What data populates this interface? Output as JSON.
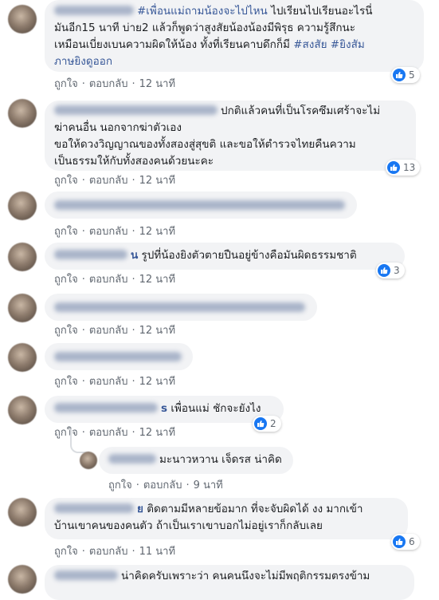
{
  "actions": {
    "like": "ถูกใจ",
    "reply": "ตอบกลับ",
    "dot": "·"
  },
  "colors": {
    "bubble": "#f2f3f5",
    "link": "#385898",
    "meta": "#606770",
    "like_blue": "#1877f2"
  },
  "comments": [
    {
      "name_tail": "",
      "lines": [
        {
          "segments": [
            {
              "t": "#เพื่อนแม่ถามน้องจะไปไหน",
              "link": true
            },
            {
              "t": " ไปเรียนไปเรียนอะไรนี่"
            }
          ]
        },
        {
          "segments": [
            {
              "t": "มันอีก15 นาที บ่าย2 แล้วก็พูดว่าสูงสัยน้องน้องมีพิรุธ ความรู้สึกนะ"
            }
          ]
        },
        {
          "segments": [
            {
              "t": "เหมือนเบี่ยงเบนความผิดให้น้อง ทั้งที่เรียนคาบดึกก็มี "
            },
            {
              "t": "#สงสัย #ยิงสัม",
              "link": true
            }
          ]
        },
        {
          "segments": [
            {
              "t": "ภาษยิงดูออก",
              "link": true
            }
          ]
        }
      ],
      "time": "12 นาที",
      "reaction_count": "5"
    },
    {
      "name_tail": "",
      "lines": [
        {
          "segments": [
            {
              "t": "ปกติแล้วคนที่เป็นโรคซึมเศร้าจะไม่"
            }
          ]
        },
        {
          "segments": [
            {
              "t": "ฆ่าคนอื่น นอกจากฆ่าตัวเอง"
            }
          ]
        },
        {
          "segments": [
            {
              "t": "ขอให้ดวงวิญญาณของทั้งสองสู่สุขติ และขอให้ตำรวจไทยคืนความ"
            }
          ]
        },
        {
          "segments": [
            {
              "t": "เป็นธรรมให้กับทั้งสองคนด้วยนะคะ"
            }
          ]
        }
      ],
      "time": "12 นาที",
      "reaction_count": "13"
    },
    {
      "name_tail": "",
      "lines": [
        {
          "segments": [
            {
              "t": ""
            }
          ]
        }
      ],
      "time": "12 นาที",
      "reaction_count": ""
    },
    {
      "name_tail": "น",
      "lines": [
        {
          "segments": [
            {
              "t": "รูปที่น้องยิงตัวตายปืนอยู่ข้างคือมันผิดธรรมชาติ"
            }
          ]
        }
      ],
      "time": "12 นาที",
      "reaction_count": "3"
    },
    {
      "name_tail": "",
      "lines": [
        {
          "segments": [
            {
              "t": ""
            }
          ]
        }
      ],
      "time": "12 นาที",
      "reaction_count": ""
    },
    {
      "name_tail": "",
      "lines": [
        {
          "segments": [
            {
              "t": ""
            }
          ]
        }
      ],
      "time": "12 นาที",
      "reaction_count": ""
    },
    {
      "name_tail": "s",
      "lines": [
        {
          "segments": [
            {
              "t": "เพื่อนแม่ ชักจะยังไง"
            }
          ]
        }
      ],
      "time": "12 นาที",
      "reaction_count": "2"
    },
    {
      "name_tail": "",
      "lines": [
        {
          "segments": [
            {
              "t": "มะนาวหวาน เจ็ดรส น่าคิด"
            }
          ]
        }
      ],
      "time": "9 นาที",
      "reaction_count": ""
    },
    {
      "name_tail": "ย",
      "lines": [
        {
          "segments": [
            {
              "t": "ติดตามมีหลายข้อมาก ที่จะจับผิดได้ งง มากเข้า"
            }
          ]
        },
        {
          "segments": [
            {
              "t": "บ้านเขาคนของคนตัว ถ้าเป็นเราเขาบอกไม่อยู่เราก็กลับเลย"
            }
          ]
        }
      ],
      "time": "11 นาที",
      "reaction_count": "6"
    },
    {
      "name_tail": "",
      "lines": [
        {
          "segments": [
            {
              "t": "น่าคิดครับเพราะว่า คนคนนึงจะไม่มีพฤติกรรมตรงข้าม"
            }
          ]
        }
      ],
      "time": "",
      "reaction_count": ""
    }
  ]
}
